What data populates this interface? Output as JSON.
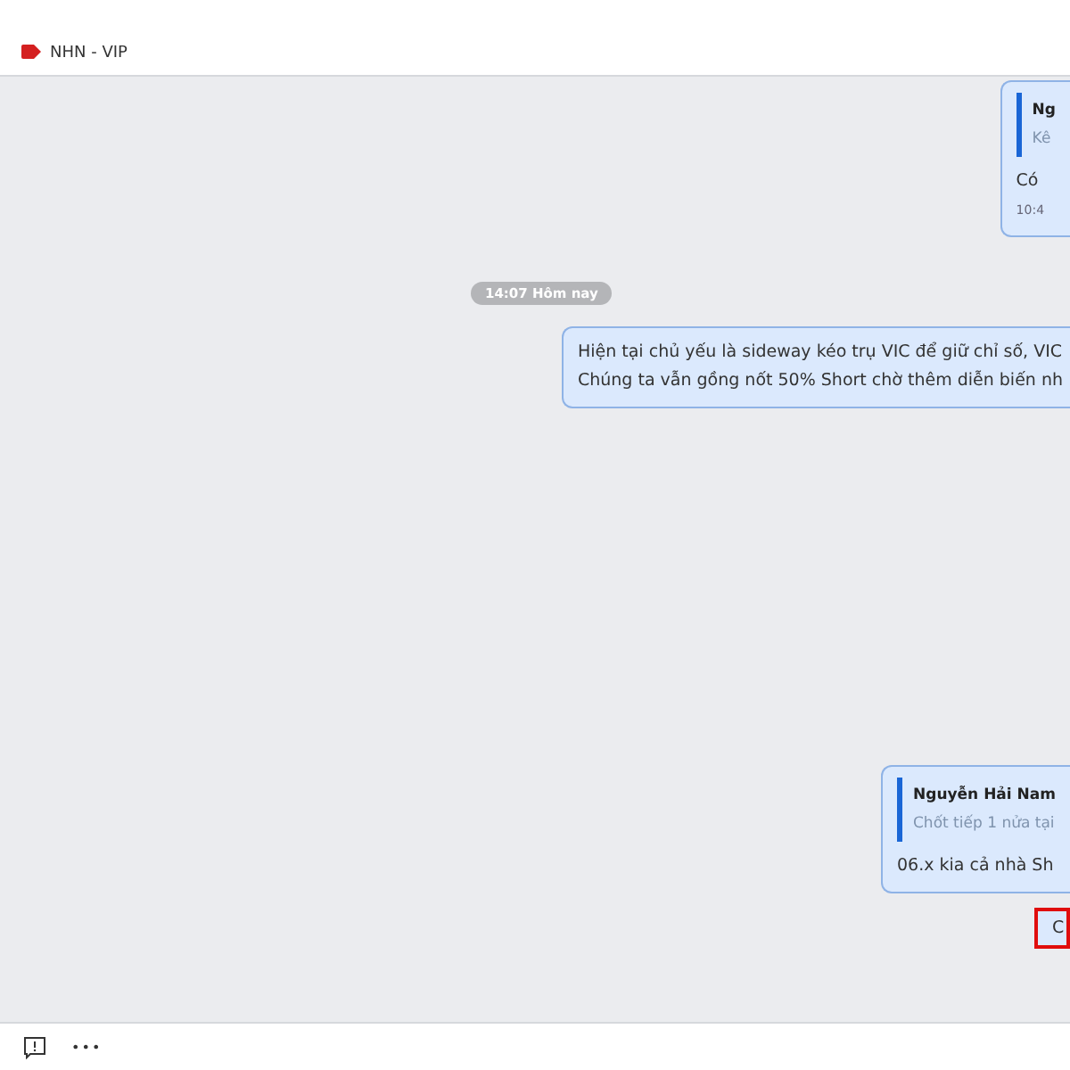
{
  "header": {
    "label": "NHN - VIP"
  },
  "messages": [
    {
      "kind": "quoted",
      "quote_author": "Ng",
      "quote_text": "Kê",
      "text": "Có",
      "time": "10:4"
    },
    {
      "kind": "divider",
      "text": "14:07 Hôm nay"
    },
    {
      "kind": "plain",
      "lines": [
        "Hiện tại chủ yếu là sideway kéo trụ VIC để giữ chỉ số, VIC",
        "Chúng ta vẫn gồng nốt 50% Short chờ thêm diễn biến nh"
      ]
    },
    {
      "kind": "quoted",
      "quote_author": "Nguyễn Hải Nam",
      "quote_text": "Chốt tiếp 1 nửa tại",
      "text": "06.x kia cả nhà Sh"
    },
    {
      "kind": "highlighted",
      "text": "C"
    }
  ],
  "footer": {
    "more": "•••"
  }
}
